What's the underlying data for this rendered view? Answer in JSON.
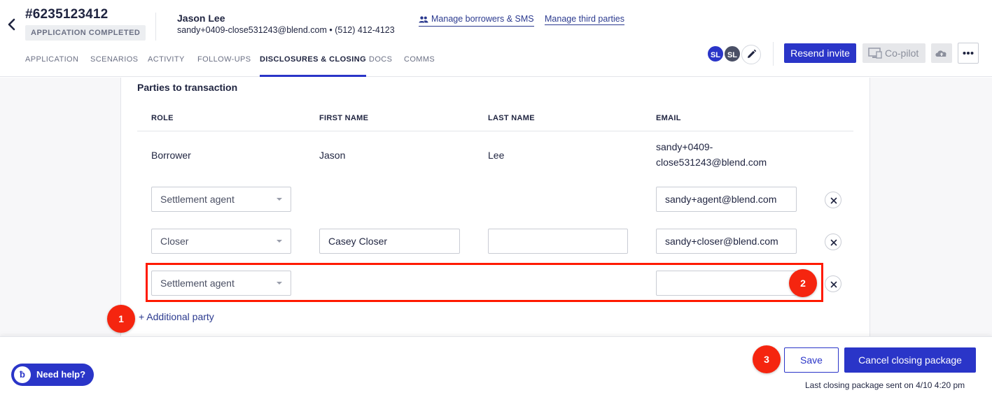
{
  "header": {
    "application_id": "#6235123412",
    "status": "APPLICATION COMPLETED",
    "borrower_name": "Jason Lee",
    "borrower_contact": "sandy+0409-close531243@blend.com • (512) 412-4123",
    "manage_borrowers_label": "Manage borrowers & SMS",
    "manage_third_parties_label": "Manage third parties",
    "resend_invite_label": "Resend invite",
    "copilot_label": "Co-pilot",
    "avatars": [
      "SL",
      "SL"
    ],
    "colors": {
      "avatar_1": "#2a35c8",
      "avatar_2": "#4a5066"
    }
  },
  "tabs": [
    {
      "label": "APPLICATION"
    },
    {
      "label": "SCENARIOS"
    },
    {
      "label": "ACTIVITY"
    },
    {
      "label": "FOLLOW-UPS"
    },
    {
      "label": "DISCLOSURES & CLOSING",
      "active": true
    },
    {
      "label": "DOCS"
    },
    {
      "label": "COMMS"
    }
  ],
  "parties": {
    "title": "Parties to transaction",
    "columns": [
      "ROLE",
      "FIRST NAME",
      "LAST NAME",
      "EMAIL"
    ],
    "static_row": {
      "role": "Borrower",
      "first_name": "Jason",
      "last_name": "Lee",
      "email_line1": "sandy+0409-",
      "email_line2": "close531243@blend.com"
    },
    "rows": [
      {
        "role": "Settlement agent",
        "first_name": "",
        "last_name": "",
        "email": "sandy+agent@blend.com"
      },
      {
        "role": "Closer",
        "first_name": "Casey Closer",
        "last_name": "",
        "email": "sandy+closer@blend.com"
      },
      {
        "role": "Settlement agent",
        "first_name": "",
        "last_name": "",
        "email": ""
      }
    ],
    "add_party_label": "+ Additional party"
  },
  "markers": [
    "1",
    "2",
    "3"
  ],
  "footer": {
    "help_label": "Need help?",
    "save_label": "Save",
    "cancel_label": "Cancel closing package",
    "note": "Last closing package sent on 4/10 4:20 pm"
  },
  "colors": {
    "primary": "#2a35c8",
    "highlight": "#ff1a00",
    "marker": "#f5250f"
  }
}
